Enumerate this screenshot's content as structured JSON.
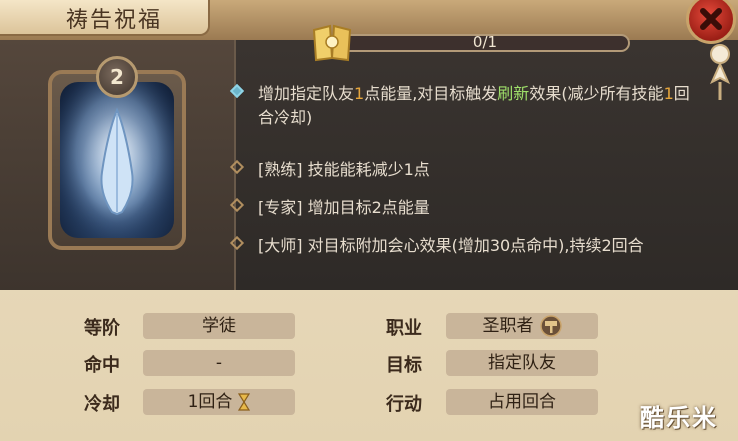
{
  "header": {
    "title": "祷告祝福"
  },
  "progress": {
    "text": "0/1",
    "value": 0,
    "max": 1
  },
  "card": {
    "level": "2"
  },
  "skill": {
    "main_description": {
      "parts": [
        "增加指定队友",
        "1",
        "点能量,对目标触发",
        "刷新",
        "效果(减少所有技能",
        "1",
        "回合冷却)"
      ]
    },
    "upgrades": [
      {
        "text": "[熟练] 技能能耗减少1点"
      },
      {
        "text": "[专家] 增加目标2点能量"
      },
      {
        "text": "[大师] 对目标附加会心效果(增加30点命中),持续2回合"
      }
    ]
  },
  "stats": {
    "rank_label": "等阶",
    "rank_value": "学徒",
    "hit_label": "命中",
    "hit_value": "-",
    "cooldown_label": "冷却",
    "cooldown_value": "1回合",
    "class_label": "职业",
    "class_value": "圣职者",
    "target_label": "目标",
    "target_value": "指定队友",
    "action_label": "行动",
    "action_value": "占用回合"
  },
  "icons": {
    "close": "close-icon",
    "book": "book-icon",
    "pin": "pin-icon",
    "hammer": "hammer-icon",
    "hourglass": "hourglass-icon",
    "praying-hands": "praying-hands-icon"
  },
  "watermark": "酷乐米"
}
